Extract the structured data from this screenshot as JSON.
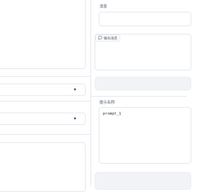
{
  "right_column": {
    "message_label": "消息",
    "output_chip": {
      "icon": "chat-icon",
      "label": "输出消息"
    },
    "prompt_name_label": "提示名称",
    "prompt_name_value": "prompt_1"
  },
  "left_column": {
    "select_1": {
      "value": "",
      "icon": "chevron-down-icon"
    },
    "select_2": {
      "value": "",
      "icon": "chevron-down-icon"
    }
  },
  "colors": {
    "border": "#e5e7eb",
    "button_bg": "#f1f3f6",
    "caret": "#111827"
  }
}
